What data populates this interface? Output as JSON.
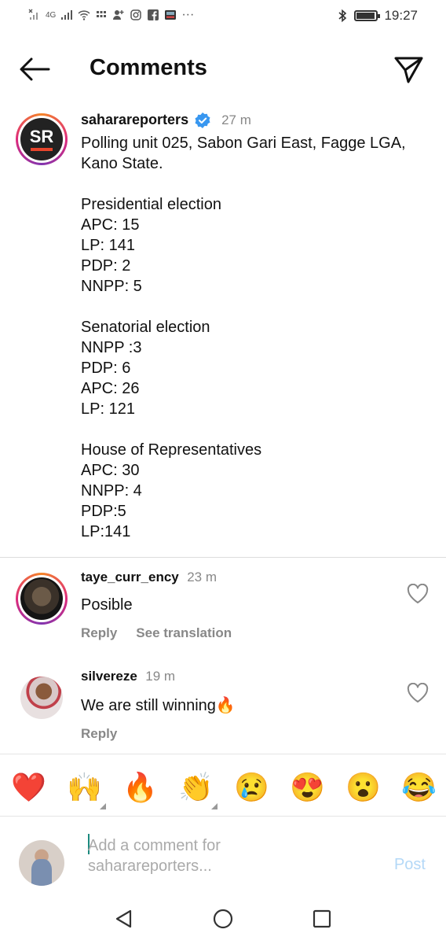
{
  "status_bar": {
    "network": "4G",
    "time": "19:27",
    "more": "···",
    "battery_level": 0.95
  },
  "header": {
    "title": "Comments"
  },
  "caption": {
    "username": "saharareporters",
    "time": "27 m",
    "avatar_text": "SR",
    "text": "Polling unit 025, Sabon Gari East, Fagge LGA, Kano State.\n\nPresidential election\nAPC: 15\nLP: 141\nPDP: 2\nNNPP: 5\n\nSenatorial election\nNNPP :3\nPDP: 6\nAPC: 26\nLP: 121\n\nHouse of Representatives\nAPC: 30\nNNPP: 4\nPDP:5\nLP:141"
  },
  "comments": [
    {
      "username": "taye_curr_ency",
      "time": "23 m",
      "text": "Posible",
      "reply_label": "Reply",
      "translate_label": "See translation"
    },
    {
      "username": "silvereze",
      "time": "19 m",
      "text": "We are still winning🔥",
      "reply_label": "Reply"
    }
  ],
  "reactions": [
    "❤️",
    "🙌",
    "🔥",
    "👏",
    "😢",
    "😍",
    "😮",
    "😂"
  ],
  "composer": {
    "placeholder": "Add a comment for saharareporters...",
    "post_label": "Post"
  },
  "colors": {
    "verified": "#3897f0",
    "post_disabled": "#b3d8f7",
    "logo_accent": "#e8452c"
  }
}
